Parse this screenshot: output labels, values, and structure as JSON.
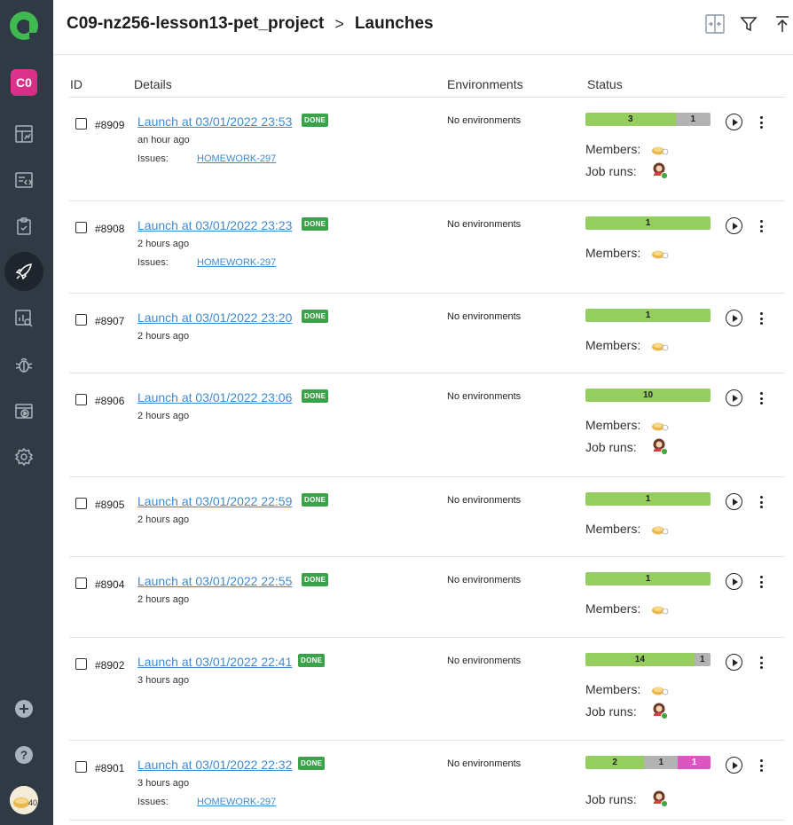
{
  "header": {
    "project": "C09-nz256-lesson13-pet_project",
    "separator": ">",
    "page": "Launches"
  },
  "sidebar": {
    "project_badge": "C0",
    "items": [
      {
        "icon": "dashboard-icon"
      },
      {
        "icon": "test-cases-icon"
      },
      {
        "icon": "test-runs-icon"
      },
      {
        "icon": "launches-icon",
        "active": true
      },
      {
        "icon": "reports-icon"
      },
      {
        "icon": "bug-icon"
      },
      {
        "icon": "video-icon"
      },
      {
        "icon": "settings-icon"
      }
    ],
    "bottom": [
      {
        "icon": "add-icon"
      },
      {
        "icon": "help-icon"
      },
      {
        "icon": "user-avatar"
      }
    ]
  },
  "columns": {
    "id": "ID",
    "details": "Details",
    "environments": "Environments",
    "status": "Status"
  },
  "labels": {
    "done": "DONE",
    "issues": "Issues:",
    "members": "Members:",
    "job_runs": "Job runs:"
  },
  "colors": {
    "passed": "#95cd60",
    "failed": "#b3b3b3",
    "skipped": "#dd56c0",
    "done_badge": "#3aa34a",
    "link": "#3f8bcf"
  },
  "launches": [
    {
      "id": "#8909",
      "title": "Launch at 03/01/2022 23:53",
      "ago": "an hour ago",
      "issue": "HOMEWORK-297",
      "env": "No environments",
      "status": [
        {
          "kind": "pass",
          "value": "3",
          "share": 0.72
        },
        {
          "kind": "fail",
          "value": "1",
          "share": 0.28
        }
      ],
      "members": true,
      "job_runs": true
    },
    {
      "id": "#8908",
      "title": "Launch at 03/01/2022 23:23",
      "ago": "2 hours ago",
      "issue": "HOMEWORK-297",
      "env": "No environments",
      "status": [
        {
          "kind": "pass",
          "value": "1",
          "share": 1
        }
      ],
      "members": true,
      "job_runs": false
    },
    {
      "id": "#8907",
      "title": "Launch at 03/01/2022 23:20",
      "ago": "2 hours ago",
      "issue": "",
      "env": "No environments",
      "status": [
        {
          "kind": "pass",
          "value": "1",
          "share": 1
        }
      ],
      "members": true,
      "job_runs": false
    },
    {
      "id": "#8906",
      "title": "Launch at 03/01/2022 23:06",
      "ago": "2 hours ago",
      "issue": "",
      "env": "No environments",
      "status": [
        {
          "kind": "pass",
          "value": "10",
          "share": 1
        }
      ],
      "members": true,
      "job_runs": true
    },
    {
      "id": "#8905",
      "title": "Launch at 03/01/2022 22:59",
      "ago": "2 hours ago",
      "issue": "",
      "env": "No environments",
      "status": [
        {
          "kind": "pass",
          "value": "1",
          "share": 1
        }
      ],
      "members": true,
      "job_runs": false
    },
    {
      "id": "#8904",
      "title": "Launch at 03/01/2022 22:55",
      "ago": "2 hours ago",
      "issue": "",
      "env": "No environments",
      "status": [
        {
          "kind": "pass",
          "value": "1",
          "share": 1
        }
      ],
      "members": true,
      "job_runs": false
    },
    {
      "id": "#8902",
      "title": "Launch at 03/01/2022 22:41",
      "ago": "3 hours ago",
      "issue": "",
      "env": "No environments",
      "status": [
        {
          "kind": "pass",
          "value": "14",
          "share": 0.87
        },
        {
          "kind": "fail",
          "value": "1",
          "share": 0.13
        }
      ],
      "members": true,
      "job_runs": true
    },
    {
      "id": "#8901",
      "title": "Launch at 03/01/2022 22:32",
      "ago": "3 hours ago",
      "issue": "HOMEWORK-297",
      "env": "No environments",
      "status": [
        {
          "kind": "pass",
          "value": "2",
          "share": 0.47
        },
        {
          "kind": "fail",
          "value": "1",
          "share": 0.27
        },
        {
          "kind": "skip",
          "value": "1",
          "share": 0.26
        }
      ],
      "members": false,
      "job_runs": true
    }
  ]
}
